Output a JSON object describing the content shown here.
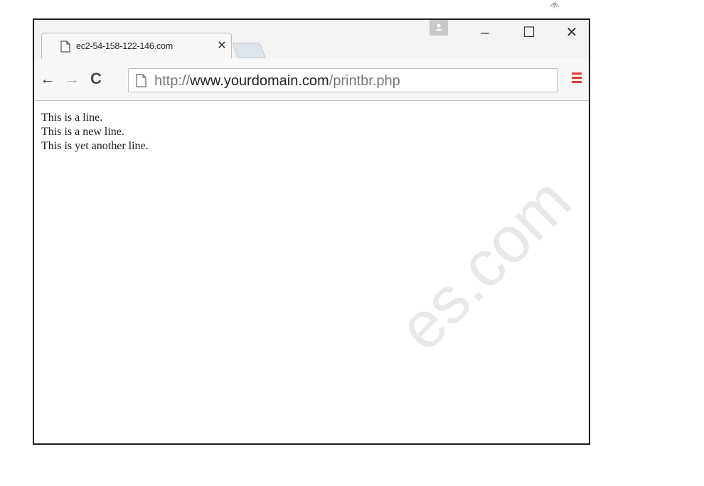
{
  "window": {
    "tab": {
      "title": "ec2-54-158-122-146.com",
      "close_glyph": "✕",
      "icon": "document-icon"
    },
    "controls": {
      "minimize": "–",
      "maximize": "☐",
      "close": "✕",
      "profile_icon": "profile-icon"
    }
  },
  "toolbar": {
    "back_glyph": "←",
    "forward_glyph": "→",
    "reload_glyph": "C",
    "url": {
      "scheme": "http://",
      "host": "www.yourdomain.com",
      "path": "/printbr.php"
    },
    "menu_icon": "hamburger-menu-icon",
    "menu_color": "#e03a2f"
  },
  "page": {
    "lines": [
      "This is a line.",
      "This is a new line.",
      "This is yet another line."
    ]
  },
  "watermark": {
    "text": "es.com"
  }
}
